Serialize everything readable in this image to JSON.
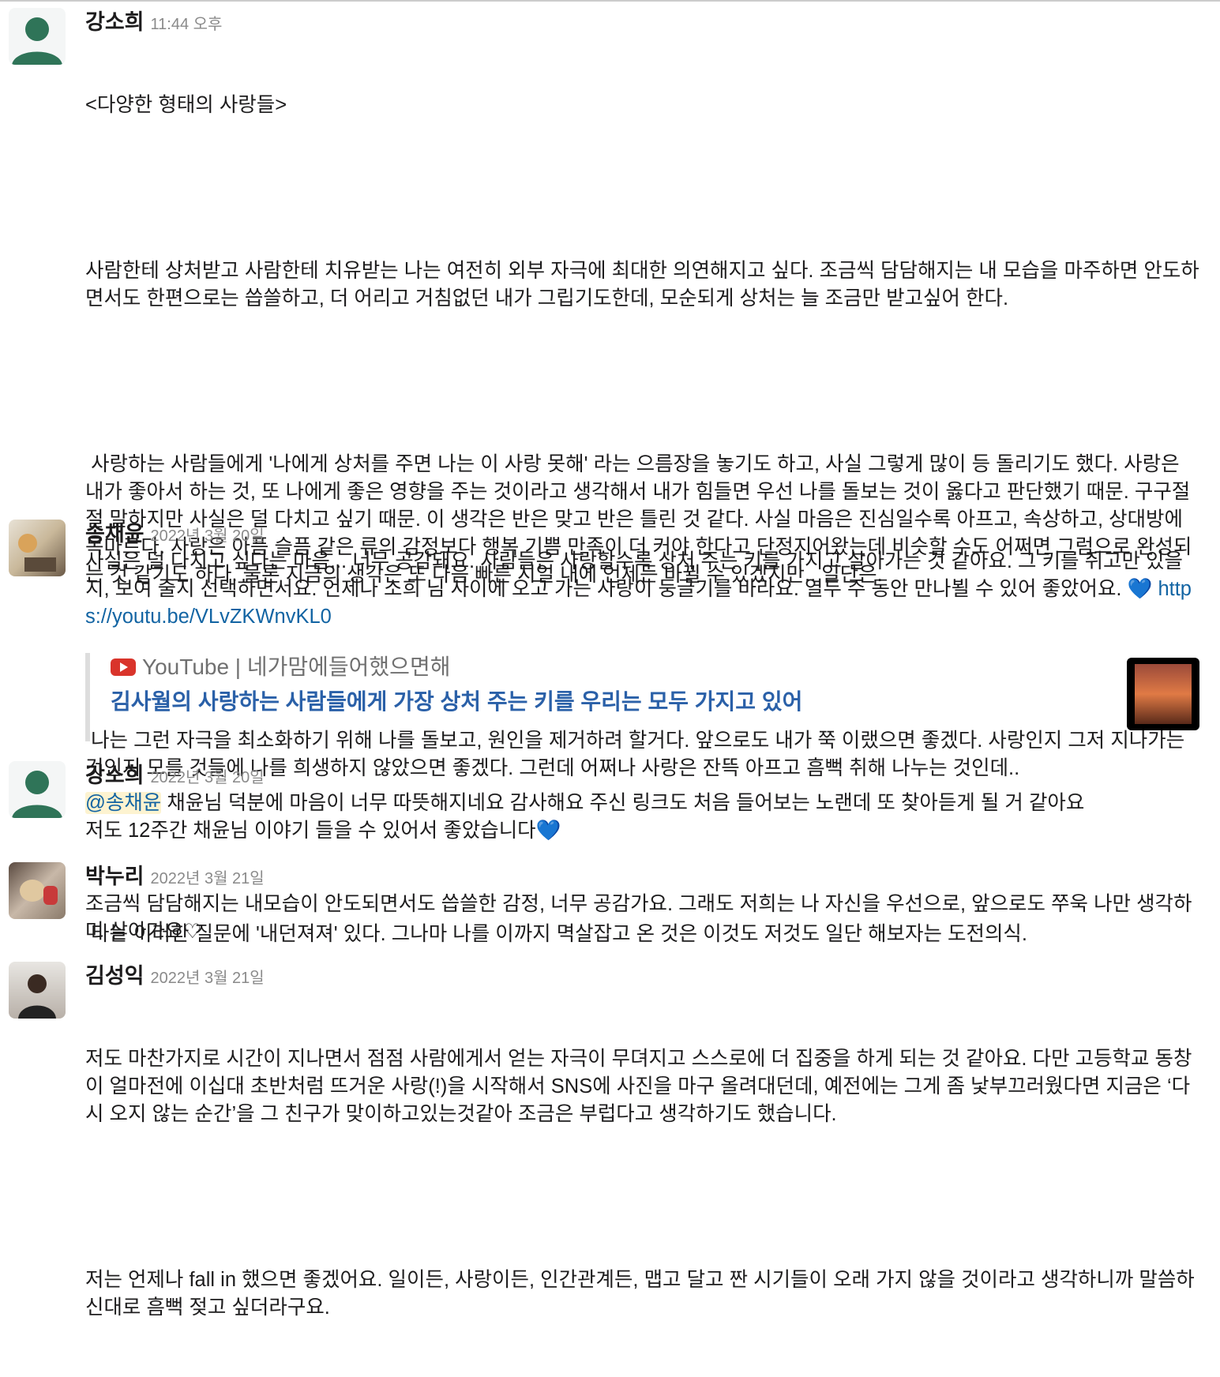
{
  "messages": [
    {
      "name": "강소희",
      "time": "11:44 오후",
      "paragraphs": [
        "<다양한 형태의 사랑들>",
        "",
        "사람한테 상처받고 사람한테 치유받는 나는 여전히 외부 자극에 최대한 의연해지고 싶다. 조금씩 담담해지는 내 모습을 마주하면 안도하면서도 한편으로는 씁쓸하고, 더 어리고 거침없던 내가 그립기도한데, 모순되게 상처는 늘 조금만 받고싶어 한다.",
        "",
        " 사랑하는 사람들에게 '나에게 상처를 주면 나는 이 사랑 못해' 라는 으름장을 놓기도 하고, 사실 그렇게 많이 등 돌리기도 했다. 사랑은 내가 좋아서 하는 것, 또 나에게 좋은 영향을 주는 것이라고 생각해서 내가 힘들면 우선 나를 돌보는 것이 옳다고 판단했기 때문. 구구절절 말하지만 사실은 덜 다치고 싶기 때문. 이 생각은 반은 맞고 반은 틀린 것 같다. 사실 마음은 진심일수록 아프고, 속상하고, 상대방에 목마르다. 사랑은 아픔 슬픔 같은 류의 감정보다 행복 기쁨 만족이 더 커야 한다고 단정지어왔는데 비슷할 수도 어쩌면 그럼으로 완성되는 것 같기도 하다. 물론 지금의 생각은 또 다음 빠른 시일 내에 언제든 바뀔 수 있겠지만.. 일단은.",
        "",
        " 나는 그런 자극을 최소화하기 위해 나를 돌보고, 원인을 제거하려 할거다. 앞으로도 내가 쭉 이랬으면 좋겠다. 사랑인지 그저 지나가는 것인지 모를 것들에 나를 희생하지 않았으면 좋겠다. 그런데 어쩌나 사랑은 잔뜩 아프고 흠뻑 취해 나누는 것인데..",
        "",
        " 나는 이러한 질문에 '내던져져' 있다. 그나마 나를 이까지 멱살잡고 온 것은 이것도 저것도 일단 해보자는 도전의식."
      ]
    },
    {
      "name": "송채윤",
      "time": "2022년 3월 20일",
      "text": "사실은 덜 다치고 싶다는 마음... 너무 공감돼요. 사람들은 사랑할수록 상처 주는 키를 가지고 살아가는 것 같아요. 그 키를 쥐고만 있을지, 보여 줄지 선택하면서요. 언제나 소희 님 사이에 오고 가는 사랑이 둥글기를 바라요. 열두 주 동안 만나뵐 수 있어 좋았어요. ",
      "heart": "💙",
      "link": "https://youtu.be/VLvZKWnvKL0",
      "card": {
        "source": "YouTube | 네가맘에들어했으면해",
        "title": "김사월의 사랑하는 사람들에게 가장 상처 주는 키를 우리는 모두 가지고 있어"
      }
    },
    {
      "name": "강소희",
      "time": "2022년 3월 20일",
      "mention": "@송채윤",
      "text": " 채윤님 덕분에 마음이 너무 따뜻해지네요 감사해요 주신 링크도 처음 들어보는 노랜데 또 찾아듣게 될 거 같아요\n저도 12주간 채윤님 이야기 들을 수 있어서 좋았습니다",
      "heart": "💙"
    },
    {
      "name": "박누리",
      "time": "2022년 3월 21일",
      "text": "조금씩 담담해지는 내모습이 안도되면서도 씁쓸한 감정, 너무 공감가요. 그래도 저희는 나 자신을 우선으로, 앞으로도 쭈욱 나만 생각하며 살아가요♡"
    },
    {
      "name": "김성익",
      "time": "2022년 3월 21일",
      "paragraphs": [
        "저도 마찬가지로 시간이 지나면서 점점 사람에게서 얻는 자극이 무뎌지고 스스로에 더 집중을 하게 되는 것 같아요. 다만 고등학교 동창이 얼마전에 이십대 초반처럼 뜨거운 사랑(!)을 시작해서 SNS에 사진을 마구 올려대던데, 예전에는 그게 좀 낯부끄러웠다면 지금은 ‘다시 오지 않는 순간’을 그 친구가 맞이하고있는것같아 조금은 부럽다고 생각하기도 했습니다.",
        "",
        "저는 언제나 fall in 했으면 좋겠어요. 일이든, 사랑이든, 인간관계든, 맵고 달고 짠 시기들이 오래 가지 않을 것이라고 생각하니까 말씀하신대로 흠뻑 젖고 싶더라구요."
      ]
    }
  ]
}
